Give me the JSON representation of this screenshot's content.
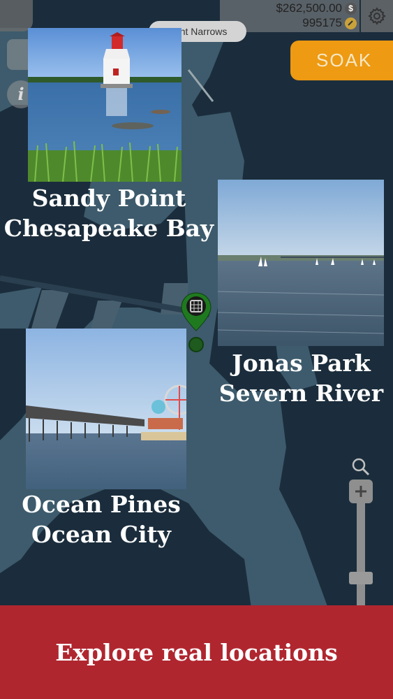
{
  "hud": {
    "money": "$262,500.00",
    "money_icon": "dollar-coin-icon",
    "coins": "995175",
    "coins_icon": "gold-coin-icon",
    "location": "Kent Narrows",
    "settings_icon": "gear-icon",
    "soak_label": "SOAK"
  },
  "photos": [
    {
      "id": "sandy-point",
      "line1": "Sandy Point",
      "line2": "Chesapeake Bay"
    },
    {
      "id": "jonas-park",
      "line1": "Jonas Park",
      "line2": "Severn River"
    },
    {
      "id": "ocean-pines",
      "line1": "Ocean Pines",
      "line2": "Ocean City"
    }
  ],
  "banner": {
    "text": "Explore real locations"
  },
  "colors": {
    "water": "#1b2d3c",
    "land": "#3d5b6c",
    "accent_orange": "#ee9a12",
    "banner_red": "#b0262f",
    "pin_green": "#1f7a1f"
  }
}
